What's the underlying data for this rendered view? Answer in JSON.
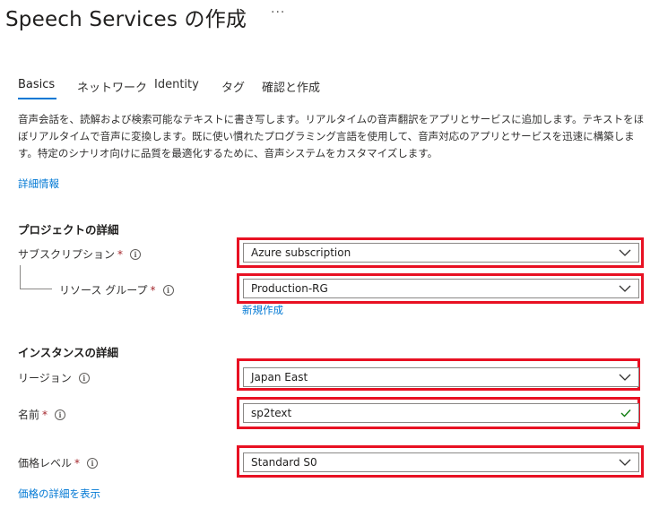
{
  "header": {
    "title": "Speech Services の作成",
    "more": "···"
  },
  "tabs": [
    {
      "label": "Basics"
    },
    {
      "label": "ネットワーク"
    },
    {
      "label": "Identity"
    },
    {
      "label": "タグ"
    },
    {
      "label": "確認と作成"
    }
  ],
  "description": "音声会話を、読解および検索可能なテキストに書き写します。リアルタイムの音声翻訳をアプリとサービスに追加します。テキストをほぼリアルタイムで音声に変換します。既に使い慣れたプログラミング言語を使用して、音声対応のアプリとサービスを迅速に構築します。特定のシナリオ向けに品質を最適化するために、音声システムをカスタマイズします。",
  "learn_more": "詳細情報",
  "project": {
    "heading": "プロジェクトの詳細",
    "subscription": {
      "label": "サブスクリプション",
      "required": "*",
      "value": "Azure subscription"
    },
    "resource_group": {
      "label": "リソース グループ",
      "required": "*",
      "value": "Production-RG",
      "create_new": "新規作成"
    }
  },
  "instance": {
    "heading": "インスタンスの詳細",
    "region": {
      "label": "リージョン",
      "value": "Japan East"
    },
    "name": {
      "label": "名前",
      "required": "*",
      "value": "sp2text"
    },
    "pricing": {
      "label": "価格レベル",
      "required": "*",
      "value": "Standard S0"
    },
    "pricing_link": "価格の詳細を表示"
  },
  "icons": {
    "info": "i"
  },
  "colors": {
    "accent": "#0078d4",
    "highlight": "#e81123",
    "valid": "#107c10"
  }
}
